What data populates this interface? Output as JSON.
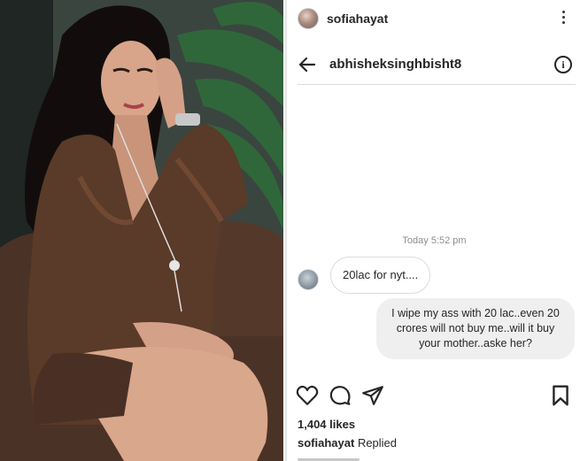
{
  "post": {
    "username": "sofiahayat",
    "likes": "1,404 likes",
    "caption_user": "sofiahayat",
    "caption_text": "Replied"
  },
  "dm": {
    "contact": "abhisheksinghbisht8",
    "timestamp": "Today 5:52 pm",
    "messages": [
      {
        "from": "them",
        "text": "20lac for nyt...."
      },
      {
        "from": "me",
        "text": "I wipe my ass with 20 lac..even 20 crores will not buy me..will it buy your mother..aske her?"
      }
    ]
  },
  "icons": {
    "more": "more-vertical-icon",
    "back": "arrow-left-icon",
    "info": "info-icon",
    "like": "heart-icon",
    "comment": "comment-icon",
    "share": "send-icon",
    "save": "bookmark-icon"
  },
  "colors": {
    "dress": "#5a3a28",
    "bubble_out": "#efefef",
    "text": "#262626",
    "muted": "#8e8e8e"
  }
}
